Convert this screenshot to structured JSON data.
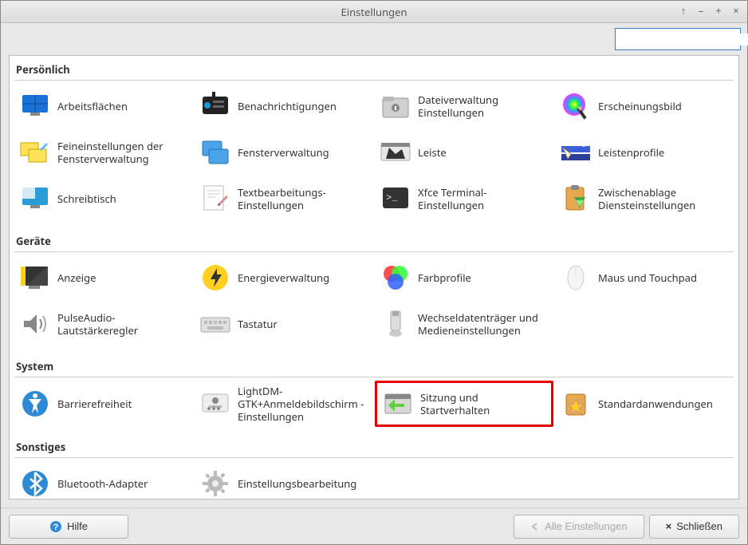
{
  "window": {
    "title": "Einstellungen"
  },
  "search": {
    "placeholder": ""
  },
  "categories": [
    {
      "title": "Persönlich",
      "items": [
        {
          "label": "Arbeitsflächen",
          "icon": "workspaces",
          "name": "workspaces"
        },
        {
          "label": "Benachrichtigungen",
          "icon": "notifications",
          "name": "notifications"
        },
        {
          "label": "Dateiverwaltung Einstellungen",
          "icon": "file-manager",
          "name": "file-manager"
        },
        {
          "label": "Erscheinungsbild",
          "icon": "appearance",
          "name": "appearance"
        },
        {
          "label": "Feineinstellungen der Fensterverwaltung",
          "icon": "wm-tweaks",
          "name": "wm-tweaks"
        },
        {
          "label": "Fensterverwaltung",
          "icon": "wm",
          "name": "wm"
        },
        {
          "label": "Leiste",
          "icon": "panel",
          "name": "panel"
        },
        {
          "label": "Leistenprofile",
          "icon": "panel-profiles",
          "name": "panel-profiles"
        },
        {
          "label": "Schreibtisch",
          "icon": "desktop",
          "name": "desktop"
        },
        {
          "label": "Textbearbeitungs-Einstellungen",
          "icon": "text-editor",
          "name": "text-editor"
        },
        {
          "label": "Xfce Terminal-Einstellungen",
          "icon": "terminal",
          "name": "terminal"
        },
        {
          "label": "Zwischenablage Diensteinstellungen",
          "icon": "clipboard",
          "name": "clipboard"
        }
      ]
    },
    {
      "title": "Geräte",
      "items": [
        {
          "label": "Anzeige",
          "icon": "display",
          "name": "display"
        },
        {
          "label": "Energieverwaltung",
          "icon": "power",
          "name": "power"
        },
        {
          "label": "Farbprofile",
          "icon": "color",
          "name": "color"
        },
        {
          "label": "Maus und Touchpad",
          "icon": "mouse",
          "name": "mouse"
        },
        {
          "label": "PulseAudio-Lautstärkeregler",
          "icon": "audio",
          "name": "audio"
        },
        {
          "label": "Tastatur",
          "icon": "keyboard",
          "name": "keyboard"
        },
        {
          "label": "Wechseldatenträger und Medieneinstellungen",
          "icon": "removable",
          "name": "removable"
        }
      ]
    },
    {
      "title": "System",
      "items": [
        {
          "label": "Barrierefreiheit",
          "icon": "accessibility",
          "name": "accessibility"
        },
        {
          "label": "LightDM-GTK+Anmeldebildschirm - Einstellungen",
          "icon": "lightdm",
          "name": "lightdm"
        },
        {
          "label": "Sitzung und Startverhalten",
          "icon": "session",
          "name": "session",
          "highlight": true
        },
        {
          "label": "Standardanwendungen",
          "icon": "default-apps",
          "name": "default-apps"
        }
      ]
    },
    {
      "title": "Sonstiges",
      "items": [
        {
          "label": "Bluetooth-Adapter",
          "icon": "bluetooth",
          "name": "bluetooth"
        },
        {
          "label": "Einstellungsbearbeitung",
          "icon": "settings-editor",
          "name": "settings-editor"
        }
      ]
    }
  ],
  "footer": {
    "help": "Hilfe",
    "all_settings": "Alle Einstellungen",
    "close": "Schließen"
  }
}
